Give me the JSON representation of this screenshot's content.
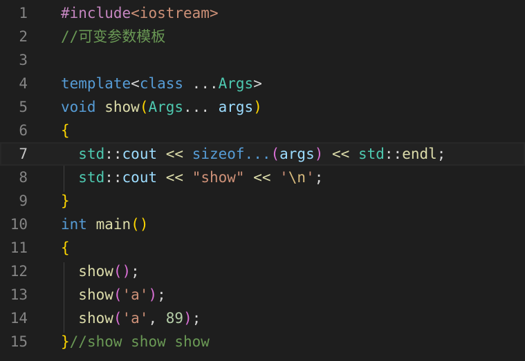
{
  "editor": {
    "current_line": 7,
    "lines": [
      {
        "n": "1",
        "tokens": [
          {
            "t": "#include",
            "c": "#c586c0"
          },
          {
            "t": "<iostream>",
            "c": "#ce9178"
          }
        ]
      },
      {
        "n": "2",
        "tokens": [
          {
            "t": "//可变参数模板",
            "c": "#6a9955"
          }
        ]
      },
      {
        "n": "3",
        "tokens": []
      },
      {
        "n": "4",
        "tokens": [
          {
            "t": "template",
            "c": "#569cd6"
          },
          {
            "t": "<",
            "c": "#d4d4d4"
          },
          {
            "t": "class",
            "c": "#569cd6"
          },
          {
            "t": " ...",
            "c": "#d4d4d4"
          },
          {
            "t": "Args",
            "c": "#4ec9b0"
          },
          {
            "t": ">",
            "c": "#d4d4d4"
          }
        ]
      },
      {
        "n": "5",
        "tokens": [
          {
            "t": "void",
            "c": "#569cd6"
          },
          {
            "t": " ",
            "c": "#d4d4d4"
          },
          {
            "t": "show",
            "c": "#dcdcaa"
          },
          {
            "t": "(",
            "c": "#ffd700"
          },
          {
            "t": "Args",
            "c": "#4ec9b0"
          },
          {
            "t": "... ",
            "c": "#d4d4d4"
          },
          {
            "t": "args",
            "c": "#9cdcfe"
          },
          {
            "t": ")",
            "c": "#ffd700"
          }
        ]
      },
      {
        "n": "6",
        "tokens": [
          {
            "t": "{",
            "c": "#ffd700"
          }
        ]
      },
      {
        "n": "7",
        "tokens": [
          {
            "t": "  ",
            "c": "#d4d4d4"
          },
          {
            "t": "std",
            "c": "#4ec9b0"
          },
          {
            "t": "::",
            "c": "#d4d4d4"
          },
          {
            "t": "cout",
            "c": "#9cdcfe"
          },
          {
            "t": " << ",
            "c": "#dcdcaa"
          },
          {
            "t": "sizeof...",
            "c": "#569cd6"
          },
          {
            "t": "(",
            "c": "#da70d6"
          },
          {
            "t": "args",
            "c": "#9cdcfe"
          },
          {
            "t": ")",
            "c": "#da70d6"
          },
          {
            "t": " << ",
            "c": "#dcdcaa"
          },
          {
            "t": "std",
            "c": "#4ec9b0"
          },
          {
            "t": "::",
            "c": "#d4d4d4"
          },
          {
            "t": "endl",
            "c": "#dcdcaa"
          },
          {
            "t": ";",
            "c": "#d4d4d4"
          }
        ]
      },
      {
        "n": "8",
        "tokens": [
          {
            "t": "  ",
            "c": "#d4d4d4"
          },
          {
            "t": "std",
            "c": "#4ec9b0"
          },
          {
            "t": "::",
            "c": "#d4d4d4"
          },
          {
            "t": "cout",
            "c": "#9cdcfe"
          },
          {
            "t": " << ",
            "c": "#dcdcaa"
          },
          {
            "t": "\"show\"",
            "c": "#ce9178"
          },
          {
            "t": " << ",
            "c": "#dcdcaa"
          },
          {
            "t": "'",
            "c": "#ce9178"
          },
          {
            "t": "\\n",
            "c": "#d7ba7d"
          },
          {
            "t": "'",
            "c": "#ce9178"
          },
          {
            "t": ";",
            "c": "#d4d4d4"
          }
        ]
      },
      {
        "n": "9",
        "tokens": [
          {
            "t": "}",
            "c": "#ffd700"
          }
        ]
      },
      {
        "n": "10",
        "tokens": [
          {
            "t": "int",
            "c": "#569cd6"
          },
          {
            "t": " ",
            "c": "#d4d4d4"
          },
          {
            "t": "main",
            "c": "#dcdcaa"
          },
          {
            "t": "()",
            "c": "#ffd700"
          }
        ]
      },
      {
        "n": "11",
        "tokens": [
          {
            "t": "{",
            "c": "#ffd700"
          }
        ]
      },
      {
        "n": "12",
        "tokens": [
          {
            "t": "  ",
            "c": "#d4d4d4"
          },
          {
            "t": "show",
            "c": "#dcdcaa"
          },
          {
            "t": "()",
            "c": "#da70d6"
          },
          {
            "t": ";",
            "c": "#d4d4d4"
          }
        ]
      },
      {
        "n": "13",
        "tokens": [
          {
            "t": "  ",
            "c": "#d4d4d4"
          },
          {
            "t": "show",
            "c": "#dcdcaa"
          },
          {
            "t": "(",
            "c": "#da70d6"
          },
          {
            "t": "'a'",
            "c": "#ce9178"
          },
          {
            "t": ")",
            "c": "#da70d6"
          },
          {
            "t": ";",
            "c": "#d4d4d4"
          }
        ]
      },
      {
        "n": "14",
        "tokens": [
          {
            "t": "  ",
            "c": "#d4d4d4"
          },
          {
            "t": "show",
            "c": "#dcdcaa"
          },
          {
            "t": "(",
            "c": "#da70d6"
          },
          {
            "t": "'a'",
            "c": "#ce9178"
          },
          {
            "t": ", ",
            "c": "#d4d4d4"
          },
          {
            "t": "89",
            "c": "#b5cea8"
          },
          {
            "t": ")",
            "c": "#da70d6"
          },
          {
            "t": ";",
            "c": "#d4d4d4"
          }
        ]
      },
      {
        "n": "15",
        "tokens": [
          {
            "t": "}",
            "c": "#ffd700"
          },
          {
            "t": "//show show show",
            "c": "#6a9955"
          }
        ]
      }
    ]
  }
}
